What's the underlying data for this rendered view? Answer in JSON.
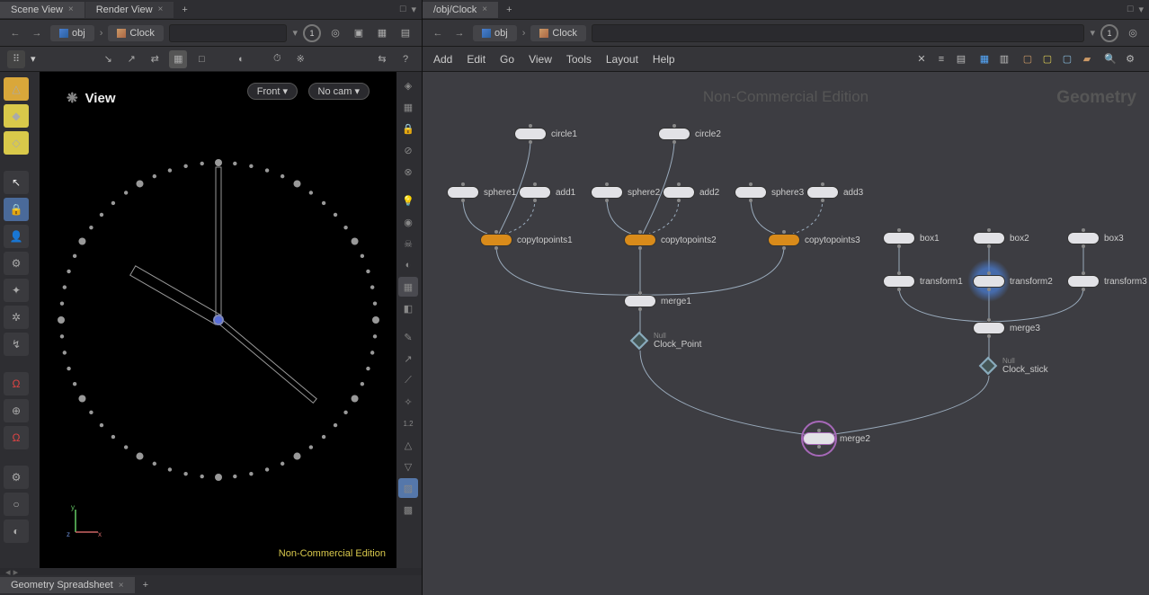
{
  "left": {
    "tabs": [
      {
        "label": "Scene View",
        "active": true
      },
      {
        "label": "Render View",
        "active": false
      }
    ],
    "path": {
      "level1": "obj",
      "level2": "Clock"
    },
    "pinnum": "1",
    "viewport": {
      "title": "View",
      "front_dropdown": "Front",
      "cam_dropdown": "No cam",
      "nce": "Non-Commercial Edition",
      "axis": {
        "x": "x",
        "y": "y",
        "z": "z"
      }
    },
    "bottom_tab": "Geometry Spreadsheet"
  },
  "right": {
    "tabs": [
      {
        "label": "/obj/Clock",
        "active": true
      }
    ],
    "path": {
      "level1": "obj",
      "level2": "Clock"
    },
    "pinnum": "1",
    "menus": [
      "Add",
      "Edit",
      "Go",
      "View",
      "Tools",
      "Layout",
      "Help"
    ],
    "watermark_center": "Non-Commercial Edition",
    "watermark_right": "Geometry",
    "nodes": {
      "circle1": "circle1",
      "circle2": "circle2",
      "sphere1": "sphere1",
      "add1": "add1",
      "sphere2": "sphere2",
      "add2": "add2",
      "sphere3": "sphere3",
      "add3": "add3",
      "ctp1": "copytopoints1",
      "ctp2": "copytopoints2",
      "ctp3": "copytopoints3",
      "box1": "box1",
      "box2": "box2",
      "box3": "box3",
      "xform1": "transform1",
      "xform2": "transform2",
      "xform3": "transform3",
      "merge1": "merge1",
      "merge3": "merge3",
      "clockpoint": "Clock_Point",
      "clockstick": "Clock_stick",
      "merge2": "merge2",
      "null_tag": "Null"
    }
  },
  "icons": {
    "search": "search",
    "gear": "gear",
    "close": "×",
    "plus": "+",
    "chevdown": "▾",
    "chevleft": "←",
    "chevright": "→",
    "minmax": "□ ▾"
  }
}
